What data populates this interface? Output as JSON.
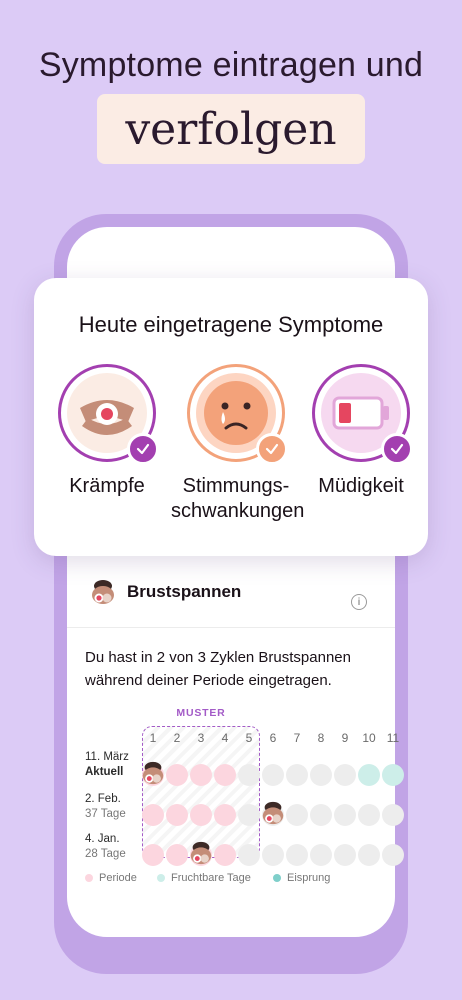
{
  "header": {
    "line1": "Symptome eintragen und",
    "line2": "verfolgen"
  },
  "card": {
    "title": "Heute eingetragene Symptome",
    "symptoms": [
      {
        "label": "Krämpfe",
        "icon": "cramps-icon",
        "ring_color": "#a33fb0",
        "bg": "#fbece4"
      },
      {
        "label": "Stimmungs-\nschwankungen",
        "icon": "sad-face-icon",
        "ring_color": "#f3a27a",
        "bg": "#fdd5c2"
      },
      {
        "label": "Müdigkeit",
        "icon": "low-battery-icon",
        "ring_color": "#a33fb0",
        "bg": "#f6d9f0"
      }
    ]
  },
  "detail": {
    "title": "Brustspannen",
    "description": "Du hast in 2 von 3 Zyklen Brustspannen während deiner Periode eingetragen.",
    "pattern_label": "MUSTER",
    "days": [
      "1",
      "2",
      "3",
      "4",
      "5",
      "6",
      "7",
      "8",
      "9",
      "10",
      "11"
    ],
    "rows": [
      {
        "date": "11. März",
        "sub": "Aktuell",
        "sub_bold": true
      },
      {
        "date": "2. Feb.",
        "sub": "37 Tage",
        "sub_bold": false
      },
      {
        "date": "4. Jan.",
        "sub": "28 Tage",
        "sub_bold": false
      }
    ],
    "legend": [
      {
        "label": "Periode",
        "color": "#fcd6df"
      },
      {
        "label": "Fruchtbare Tage",
        "color": "#cdeee9"
      },
      {
        "label": "Eisprung",
        "color": "#7fcfca"
      }
    ]
  },
  "colors": {
    "background": "#dccbf6",
    "period": "#fcd6df",
    "fertile": "#cdeee9",
    "ovulation": "#a9e1dc",
    "neutral": "#ededed",
    "accent": "#a33fb0"
  }
}
